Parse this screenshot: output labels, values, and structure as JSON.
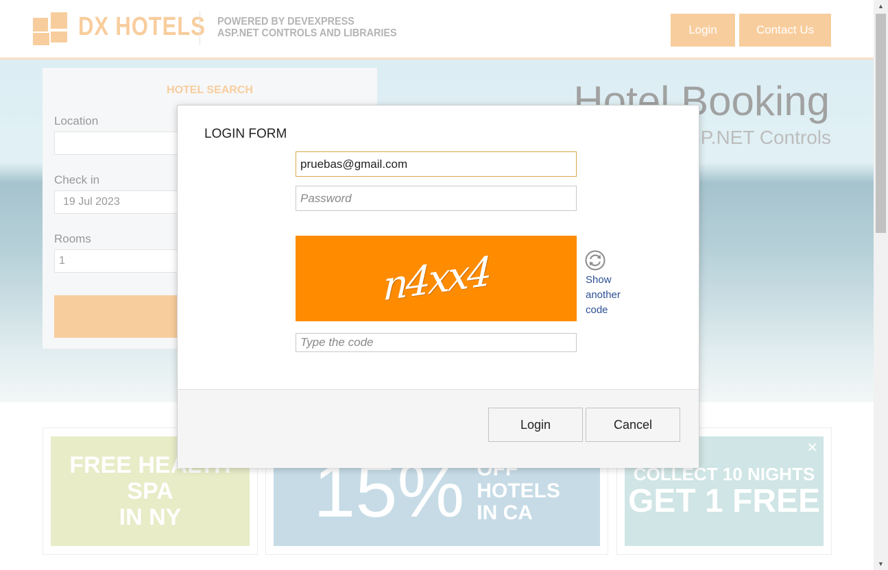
{
  "header": {
    "brand": "DX HOTELS",
    "powered_line1": "POWERED BY DEVEXPRESS",
    "powered_line2": "ASP.NET CONTROLS AND LIBRARIES",
    "login_label": "Login",
    "contact_label": "Contact Us"
  },
  "hero": {
    "title": "Hotel Booking",
    "subtitle": "ASP.NET Controls"
  },
  "search": {
    "title": "HOTEL SEARCH",
    "location_label": "Location",
    "location_value": "",
    "checkin_label": "Check in",
    "checkin_value": "19 Jul 2023",
    "rooms_label": "Rooms",
    "rooms_value": "1"
  },
  "promos": {
    "spa_line1": "FREE HEALTH SPA",
    "spa_line2": "IN NY",
    "discount_big": "15%",
    "discount_line1": "OFF",
    "discount_line2": "HOTELS",
    "discount_line3": "IN CA",
    "nights_line1": "COLLECT 10 NIGHTS",
    "nights_line2": "GET 1 FREE",
    "close_symbol": "✕"
  },
  "modal": {
    "title": "LOGIN FORM",
    "email_value": "pruebas@gmail.com",
    "password_placeholder": "Password",
    "captcha_text": "n4xx4",
    "show_code_line1": "Show",
    "show_code_line2": "another",
    "show_code_line3": "code",
    "code_placeholder": "Type the code",
    "login_label": "Login",
    "cancel_label": "Cancel"
  },
  "colors": {
    "accent": "#f3a54e",
    "captcha_bg": "#ff8c00",
    "link": "#2b4f94",
    "spa_tile": "#d6dc9a",
    "discount_tile": "#97bdd2",
    "nights_tile": "#a9d0cf"
  },
  "icons": {
    "refresh": "refresh-icon",
    "close": "close-icon",
    "logo": "dx-logo-icon"
  }
}
